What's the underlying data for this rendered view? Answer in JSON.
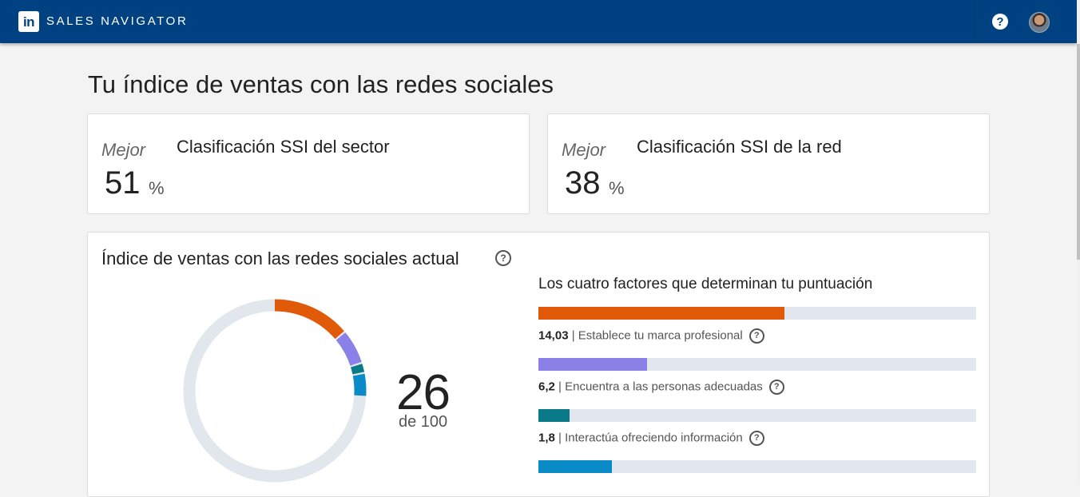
{
  "header": {
    "logo_text": "in",
    "brand": "SALES NAVIGATOR",
    "help_icon": "?",
    "bg_color": "#004182"
  },
  "page": {
    "title": "Tu índice de ventas con las redes sociales"
  },
  "rankings": [
    {
      "best_label": "Mejor",
      "value": "51",
      "unit": "%",
      "label": "Clasificación SSI del sector"
    },
    {
      "best_label": "Mejor",
      "value": "38",
      "unit": "%",
      "label": "Clasificación SSI de la red"
    }
  ],
  "ssi": {
    "title": "Índice de ventas con las redes sociales actual",
    "help_icon": "?",
    "score": "26",
    "score_sub": "de 100",
    "factors_title": "Los cuatro factores que determinan tu puntuación",
    "factors": [
      {
        "value": "14,03",
        "label": "Establece tu marca profesional",
        "score": 14.03,
        "max": 25,
        "color": "#e15a0a"
      },
      {
        "value": "6,2",
        "label": "Encuentra a las personas adecuadas",
        "score": 6.2,
        "max": 25,
        "color": "#8b7fe8"
      },
      {
        "value": "1,8",
        "label": "Interactúa ofreciendo información",
        "score": 1.8,
        "max": 25,
        "color": "#0a7a8a"
      },
      {
        "value": "",
        "label": "",
        "score": 4.2,
        "max": 25,
        "color": "#0a8bc8"
      }
    ],
    "donut_track_color": "#e2e7ee"
  }
}
